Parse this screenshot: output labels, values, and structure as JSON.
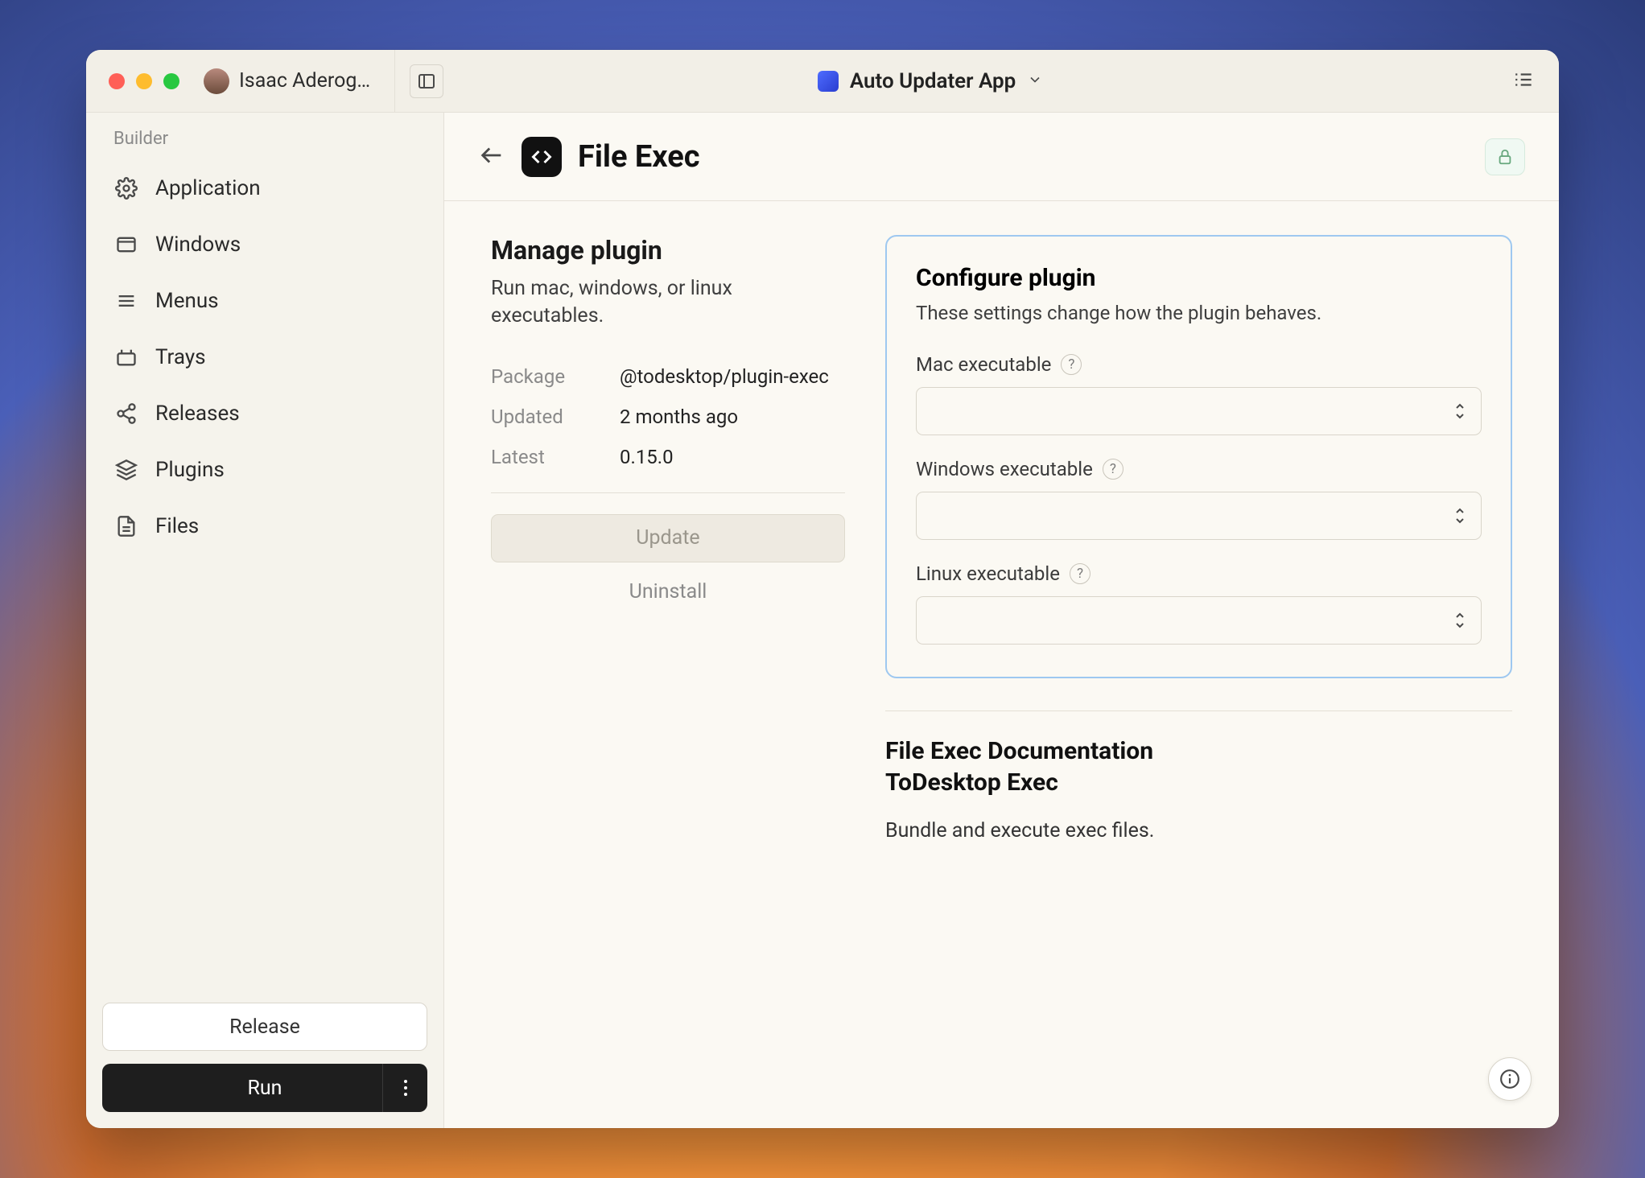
{
  "titlebar": {
    "user_name": "Isaac Aderog…",
    "project_name": "Auto Updater App"
  },
  "sidebar": {
    "section_label": "Builder",
    "items": [
      {
        "label": "Application"
      },
      {
        "label": "Windows"
      },
      {
        "label": "Menus"
      },
      {
        "label": "Trays"
      },
      {
        "label": "Releases"
      },
      {
        "label": "Plugins"
      },
      {
        "label": "Files"
      }
    ],
    "release_label": "Release",
    "run_label": "Run"
  },
  "page": {
    "title": "File Exec"
  },
  "manage": {
    "heading": "Manage plugin",
    "subheading": "Run mac, windows, or linux executables.",
    "package_key": "Package",
    "package_val": "@todesktop/plugin-exec",
    "updated_key": "Updated",
    "updated_val": "2 months ago",
    "latest_key": "Latest",
    "latest_val": "0.15.0",
    "update_btn": "Update",
    "uninstall_btn": "Uninstall"
  },
  "configure": {
    "heading": "Configure plugin",
    "desc": "These settings change how the plugin behaves.",
    "fields": [
      {
        "label": "Mac executable"
      },
      {
        "label": "Windows executable"
      },
      {
        "label": "Linux executable"
      }
    ]
  },
  "docs": {
    "title_line1": "File Exec Documentation",
    "title_line2": "ToDesktop Exec",
    "sub": "Bundle and execute exec files."
  }
}
